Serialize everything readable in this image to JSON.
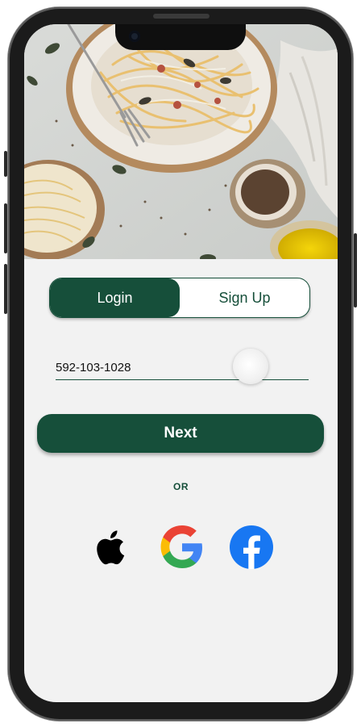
{
  "auth_tabs": {
    "login_label": "Login",
    "signup_label": "Sign Up",
    "active": "Login"
  },
  "phone_field": {
    "value": "592-103-1028"
  },
  "next_button": {
    "label": "Next"
  },
  "divider": {
    "label": "OR"
  },
  "social_logins": [
    {
      "provider": "apple",
      "icon": "apple-icon"
    },
    {
      "provider": "google",
      "icon": "google-icon"
    },
    {
      "provider": "facebook",
      "icon": "facebook-icon"
    }
  ],
  "colors": {
    "brand_green": "#164f3a",
    "background": "#f2f2f2",
    "facebook_blue": "#1877f2"
  }
}
